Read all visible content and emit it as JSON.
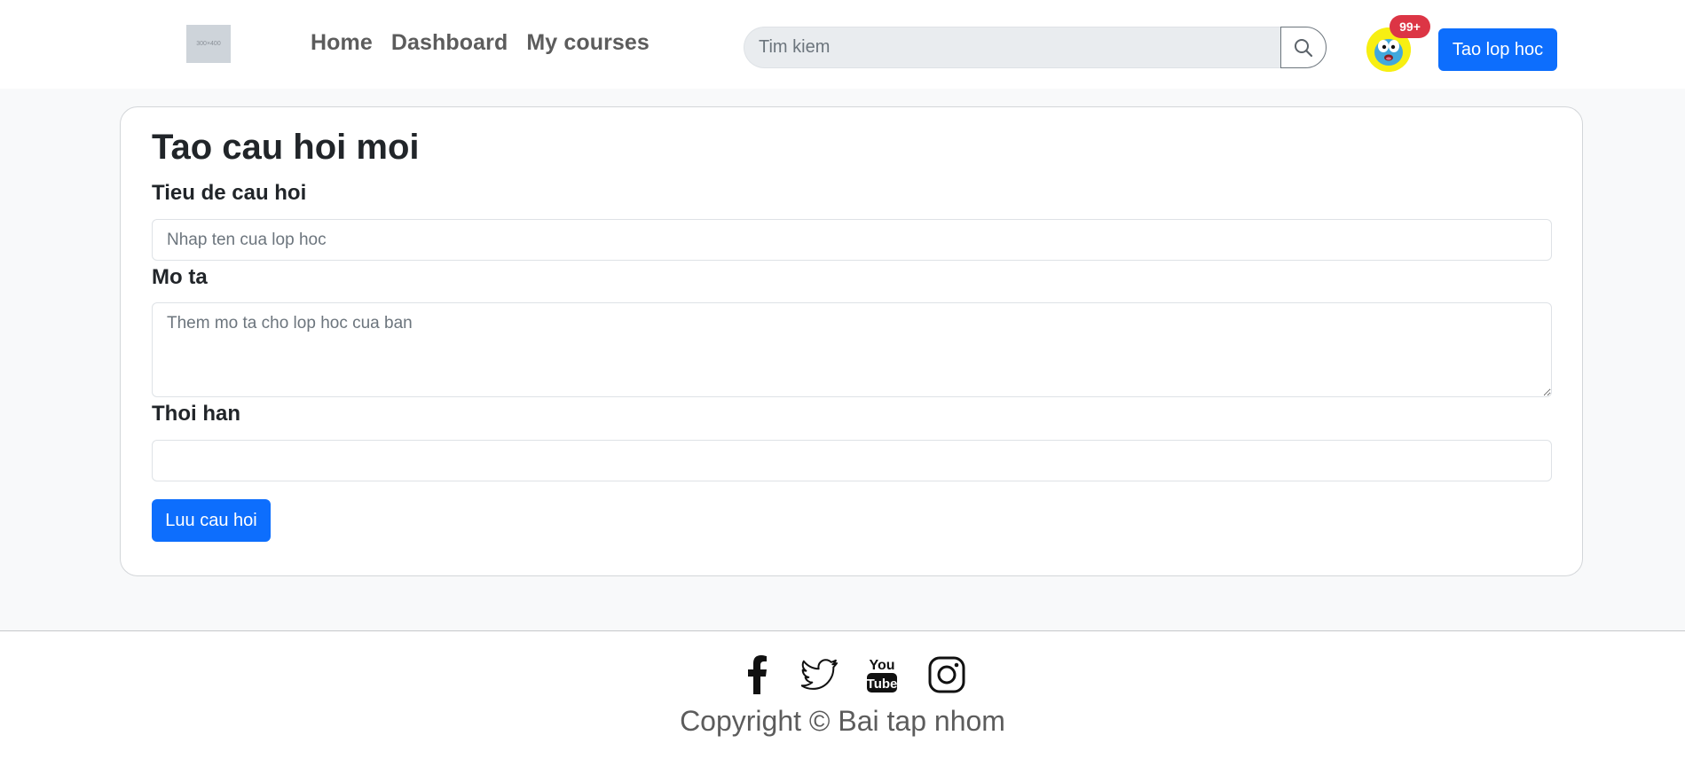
{
  "header": {
    "logo_text": "300×400",
    "nav": [
      {
        "label": "Home"
      },
      {
        "label": "Dashboard"
      },
      {
        "label": "My courses"
      }
    ],
    "search": {
      "placeholder": "Tim kiem",
      "value": ""
    },
    "notification_count": "99+",
    "create_class_label": "Tao lop hoc",
    "icons": {
      "search": "search-icon",
      "avatar": "avatar-icon"
    }
  },
  "form": {
    "title": "Tao cau hoi moi",
    "fields": {
      "question_title": {
        "label": "Tieu de cau hoi",
        "placeholder": "Nhap ten cua lop hoc",
        "value": ""
      },
      "description": {
        "label": "Mo ta",
        "placeholder": "Them mo ta cho lop hoc cua ban",
        "value": ""
      },
      "deadline": {
        "label": "Thoi han",
        "placeholder": "",
        "value": ""
      }
    },
    "submit_label": "Luu cau hoi"
  },
  "footer": {
    "social": [
      "facebook-icon",
      "twitter-icon",
      "youtube-icon",
      "instagram-icon"
    ],
    "youtube_text_top": "You",
    "youtube_text_bottom": "Tube",
    "copyright": "Copyright © Bai tap nhom"
  },
  "colors": {
    "primary": "#0d6efd",
    "badge": "#dc3545",
    "page_bg": "#f8f9fa",
    "nav_text": "#5c5c5c",
    "avatar_bg": "#f7ef12"
  }
}
